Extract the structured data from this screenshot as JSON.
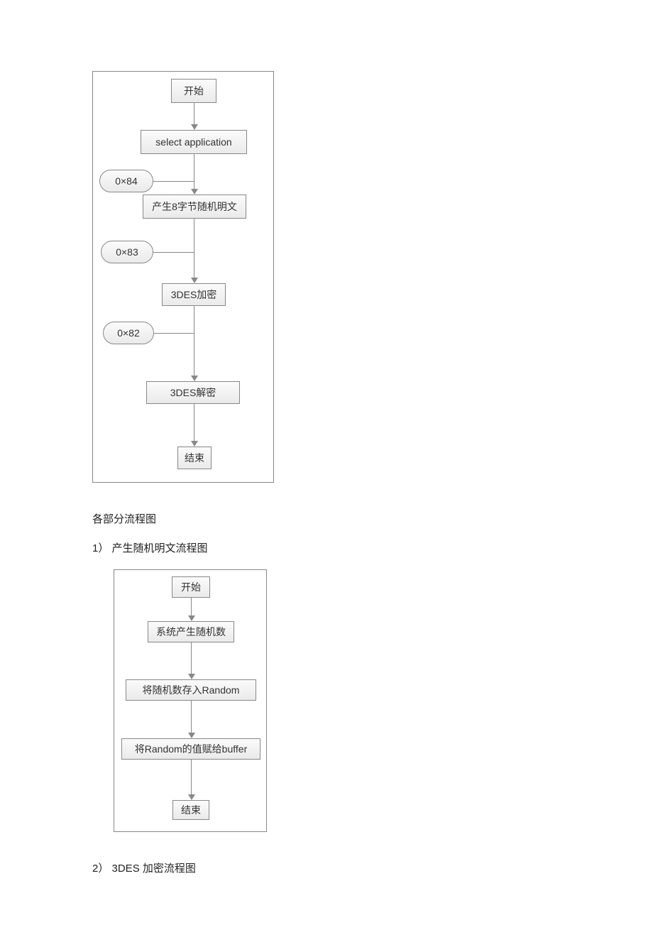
{
  "flowchart1": {
    "n1": "开始",
    "n2": "select  application",
    "n3": "产生8字节随机明文",
    "n4": "3DES加密",
    "n5": "3DES解密",
    "n6": "结束",
    "pill1": "0×84",
    "pill2": "0×83",
    "pill3": "0×82"
  },
  "section_title": "各部分流程图",
  "item1_label": "1） 产生随机明文流程图",
  "flowchart2": {
    "n1": "开始",
    "n2": "系统产生随机数",
    "n3": "将随机数存入Random",
    "n4": "将Random的值赋给buffer",
    "n5": "结束"
  },
  "item2_label": "2） 3DES 加密流程图"
}
